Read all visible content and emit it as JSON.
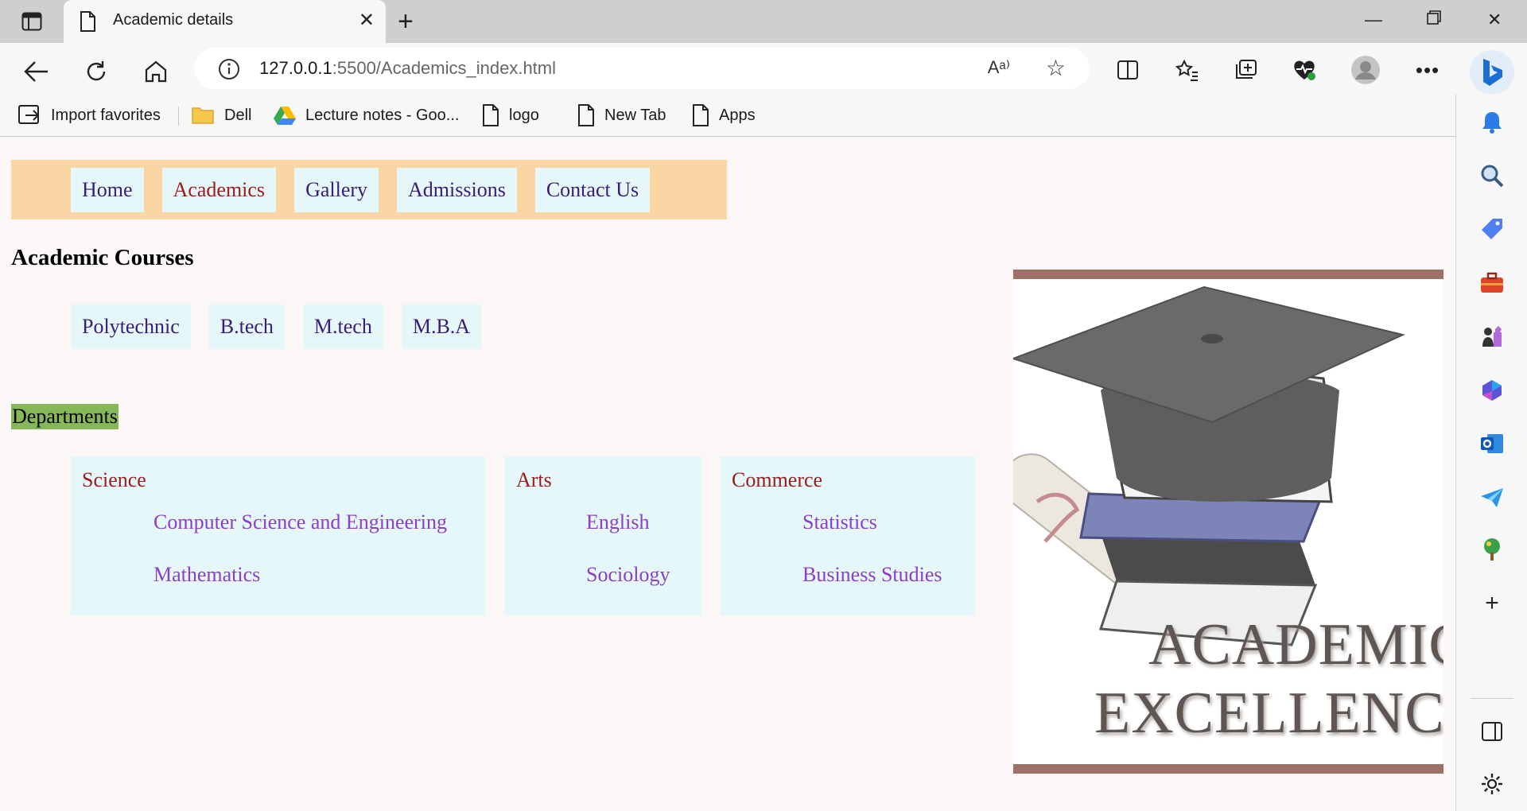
{
  "browser": {
    "tab_title": "Academic details",
    "address_host": "127.0.0.1",
    "address_rest": ":5500/Academics_index.html",
    "read_aloud_label": "Aᵃ⁾",
    "favorites": [
      {
        "label": "Import favorites",
        "icon": "import-favorites-icon"
      },
      {
        "label": "Dell",
        "icon": "folder-icon"
      },
      {
        "label": "Lecture notes - Goo...",
        "icon": "google-drive-icon"
      },
      {
        "label": "logo",
        "icon": "page-icon"
      },
      {
        "label": "New Tab",
        "icon": "page-icon"
      },
      {
        "label": "Apps",
        "icon": "page-icon"
      }
    ]
  },
  "page": {
    "nav": [
      "Home",
      "Academics",
      "Gallery",
      "Admissions",
      "Contact Us"
    ],
    "active_nav": "Academics",
    "heading": "Academic Courses",
    "courses": [
      "Polytechnic",
      "B.tech",
      "M.tech",
      "M.B.A"
    ],
    "departments_label": "Departments",
    "departments": [
      {
        "title": "Science",
        "subjects": [
          "Computer Science and Engineering",
          "Mathematics"
        ]
      },
      {
        "title": "Arts",
        "subjects": [
          "English",
          "Sociology"
        ]
      },
      {
        "title": "Commerce",
        "subjects": [
          "Statistics",
          "Business Studies"
        ]
      }
    ],
    "promo": {
      "line1": "ACADEMIC",
      "line2": "EXCELLENCE"
    }
  },
  "colors": {
    "nav_bar": "#f9d6a4",
    "item_bg": "#e5f7f8",
    "link": "#3a1d7a",
    "active": "#9b1c1c",
    "subject": "#8a3fc9",
    "dept_label_bg": "#86b85a",
    "promo_border": "#9e7067"
  }
}
